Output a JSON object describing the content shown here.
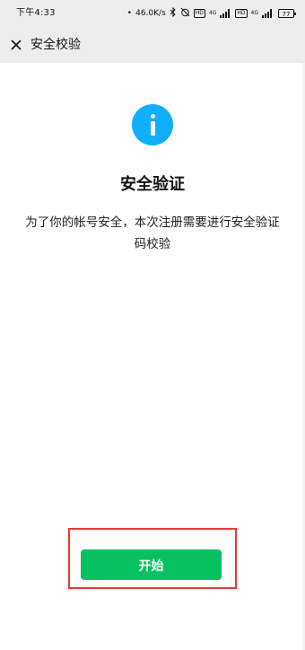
{
  "status_bar": {
    "time": "下午4:33",
    "network_speed": "46.0K/s",
    "signal_1_label": "4G",
    "signal_2_label": "4G",
    "hd_1": "HD",
    "hd_2": "HD",
    "battery": "77",
    "bluetooth_icon": "bluetooth-icon",
    "alarm_icon": "alarm-off-icon",
    "dot_separator": "•"
  },
  "nav": {
    "title": "安全校验",
    "close_icon": "close-icon"
  },
  "content": {
    "icon": "info-icon",
    "title": "安全验证",
    "description": "为了你的帐号安全，本次注册需要进行安全验证码校验"
  },
  "actions": {
    "start_label": "开始"
  },
  "colors": {
    "info_blue": "#10aeff",
    "primary_green": "#07c160",
    "highlight_red": "#e53935",
    "nav_bg": "#ededed"
  }
}
